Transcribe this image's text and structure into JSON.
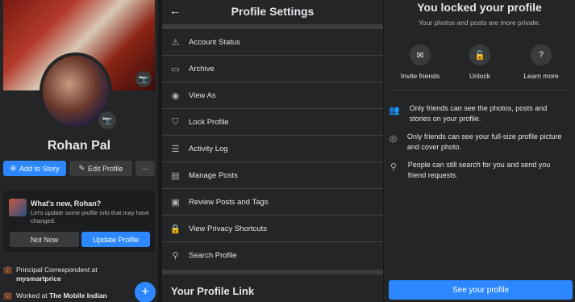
{
  "profile": {
    "name": "Rohan Pal",
    "add_story_label": "Add to Story",
    "edit_profile_label": "Edit Profile",
    "more_label": "···",
    "whats_new": {
      "title": "What's new, Rohan?",
      "text": "Let's update some profile info that may have changed.",
      "not_now_label": "Not Now",
      "update_label": "Update Profile"
    },
    "work": [
      {
        "prefix": "Principal Correspondent at",
        "place": "mysmartprice"
      },
      {
        "prefix": "Worked at",
        "place": "The Mobile Indian"
      }
    ],
    "fab_label": "+"
  },
  "settings": {
    "back_icon": "←",
    "title": "Profile Settings",
    "items": [
      {
        "label": "Account Status",
        "icon": "⚠"
      },
      {
        "label": "Archive",
        "icon": "▭"
      },
      {
        "label": "View As",
        "icon": "◉"
      },
      {
        "label": "Lock Profile",
        "icon": "⛉"
      },
      {
        "label": "Activity Log",
        "icon": "☰"
      },
      {
        "label": "Manage Posts",
        "icon": "▤"
      },
      {
        "label": "Review Posts and Tags",
        "icon": "▣"
      },
      {
        "label": "View Privacy Shortcuts",
        "icon": "🔒"
      },
      {
        "label": "Search Profile",
        "icon": "⚲"
      }
    ],
    "footer_title": "Your Profile Link"
  },
  "locked": {
    "title": "You locked your profile",
    "subtitle": "Your photos and posts are more private.",
    "features": [
      {
        "label": "Invite friends",
        "icon": "✉"
      },
      {
        "label": "Unlock",
        "icon": "🔓"
      },
      {
        "label": "Learn more",
        "icon": "?"
      }
    ],
    "info": [
      {
        "text": "Only friends can see the photos, posts and stories on your profile.",
        "icon": "👥"
      },
      {
        "text": "Only friends can see your full-size profile picture and cover photo.",
        "icon": "◎"
      },
      {
        "text": "People can still search for you and send you friend requests.",
        "icon": "⚲"
      }
    ],
    "see_profile_label": "See your profile"
  }
}
